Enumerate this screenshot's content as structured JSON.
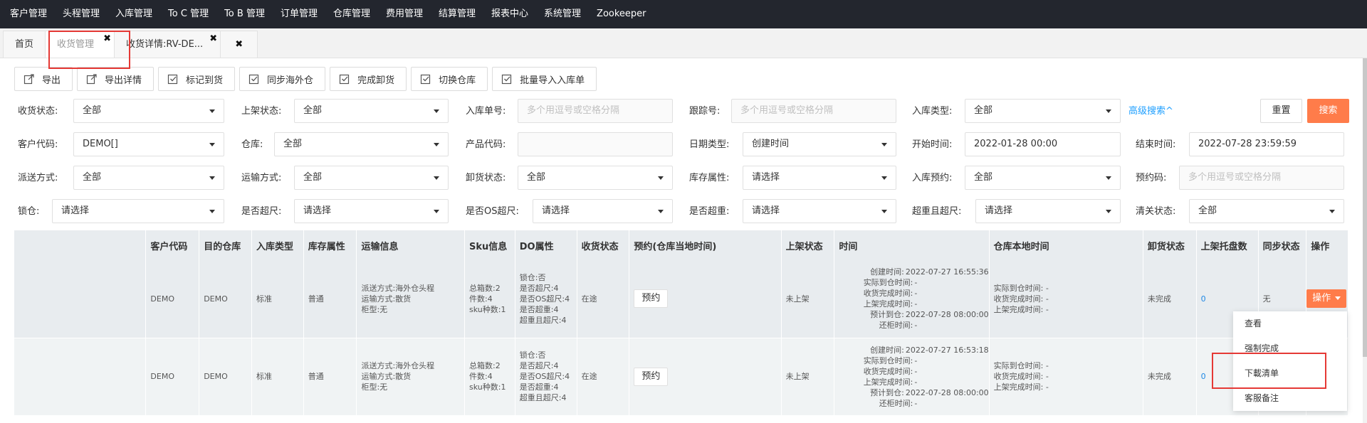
{
  "nav": [
    {
      "label": "客户管理"
    },
    {
      "label": "头程管理"
    },
    {
      "label": "入库管理"
    },
    {
      "label": "To C 管理"
    },
    {
      "label": "To B 管理"
    },
    {
      "label": "订单管理"
    },
    {
      "label": "仓库管理"
    },
    {
      "label": "费用管理"
    },
    {
      "label": "结算管理"
    },
    {
      "label": "报表中心"
    },
    {
      "label": "系统管理"
    },
    {
      "label": "Zookeeper"
    }
  ],
  "tabs": [
    {
      "label": "首页"
    },
    {
      "label": "收货管理",
      "close": "✖"
    },
    {
      "label": "收货详情:RV-DE...",
      "close": "✖"
    },
    {
      "label": "✖"
    }
  ],
  "toolbar": [
    {
      "label": "导出",
      "icon": "export-icon"
    },
    {
      "label": "导出详情",
      "icon": "export-icon"
    },
    {
      "label": "标记到货",
      "icon": "check-icon"
    },
    {
      "label": "同步海外仓",
      "icon": "check-icon"
    },
    {
      "label": "完成卸货",
      "icon": "check-icon"
    },
    {
      "label": "切换仓库",
      "icon": "check-icon"
    },
    {
      "label": "批量导入入库单",
      "icon": "check-icon"
    }
  ],
  "filters": {
    "receive_status": {
      "label": "收货状态:",
      "value": "全部"
    },
    "shelf_status": {
      "label": "上架状态:",
      "value": "全部"
    },
    "inbound_no": {
      "label": "入库单号:",
      "placeholder": "多个用逗号或空格分隔"
    },
    "tracking_no": {
      "label": "跟踪号:",
      "placeholder": "多个用逗号或空格分隔"
    },
    "inbound_type": {
      "label": "入库类型:",
      "value": "全部"
    },
    "advanced": "高级搜索^",
    "reset": "重置",
    "search": "搜索",
    "customer_code": {
      "label": "客户代码:",
      "value": "DEMO[]"
    },
    "warehouse": {
      "label": "仓库:",
      "value": "全部"
    },
    "product_code": {
      "label": "产品代码:",
      "placeholder": ""
    },
    "date_type": {
      "label": "日期类型:",
      "value": "创建时间"
    },
    "start_time": {
      "label": "开始时间:",
      "value": "2022-01-28 00:00"
    },
    "end_time": {
      "label": "结束时间:",
      "value": "2022-07-28 23:59:59"
    },
    "delivery_method": {
      "label": "派送方式:",
      "value": "全部"
    },
    "transport_method": {
      "label": "运输方式:",
      "value": "全部"
    },
    "unload_status": {
      "label": "卸货状态:",
      "value": "全部"
    },
    "stock_attr": {
      "label": "库存属性:",
      "value": "请选择"
    },
    "inbound_appt": {
      "label": "入库预约:",
      "value": "全部"
    },
    "appt_code": {
      "label": "预约码:",
      "placeholder": "多个用逗号或空格分隔"
    },
    "lock": {
      "label": "锁仓:",
      "value": "请选择"
    },
    "oversize": {
      "label": "是否超尺:",
      "value": "请选择"
    },
    "os_oversize": {
      "label": "是否OS超尺:",
      "value": "请选择"
    },
    "overweight": {
      "label": "是否超重:",
      "value": "请选择"
    },
    "ow_oversize": {
      "label": "超重且超尺:",
      "value": "请选择"
    },
    "customs_status": {
      "label": "清关状态:",
      "value": "全部"
    }
  },
  "table": {
    "headers": [
      "",
      "客户代码",
      "目的仓库",
      "入库类型",
      "库存属性",
      "运输信息",
      "Sku信息",
      "DO属性",
      "收货状态",
      "预约(仓库当地时间)",
      "上架状态",
      "时间",
      "仓库本地时间",
      "卸货状态",
      "上架托盘数",
      "同步状态",
      "操作"
    ],
    "rows": [
      {
        "customer": "DEMO",
        "dest": "DEMO",
        "type": "标准",
        "stock": "普通",
        "transport": [
          "派送方式:海外仓头程",
          "运输方式:散货",
          "柜型:无"
        ],
        "sku": [
          "总箱数:2",
          "件数:4",
          "sku种数:1"
        ],
        "do": [
          "锁仓:否",
          "是否超尺:4",
          "是否OS超尺:4",
          "是否超重:4",
          "超重且超尺:4"
        ],
        "receive_status": "在途",
        "appt_btn": "预约",
        "shelf_status": "未上架",
        "times": [
          {
            "k": "创建时间:",
            "v": "2022-07-27 16:55:36"
          },
          {
            "k": "实际到仓时间:",
            "v": "-"
          },
          {
            "k": "收货完成时间:",
            "v": "-"
          },
          {
            "k": "上架完成时间:",
            "v": "-"
          },
          {
            "k": "预计到仓:",
            "v": "2022-07-28 08:00:00"
          },
          {
            "k": "还柜时间:",
            "v": "-"
          }
        ],
        "local_times": [
          "实际到仓时间: -",
          "收货完成时间: -",
          "上架完成时间: -"
        ],
        "unload": "未完成",
        "pallets": "0",
        "sync": "无",
        "op": "操作"
      },
      {
        "customer": "DEMO",
        "dest": "DEMO",
        "type": "标准",
        "stock": "普通",
        "transport": [
          "派送方式:海外仓头程",
          "运输方式:散货",
          "柜型:无"
        ],
        "sku": [
          "总箱数:2",
          "件数:4",
          "sku种数:1"
        ],
        "do": [
          "锁仓:否",
          "是否超尺:4",
          "是否OS超尺:4",
          "是否超重:4",
          "超重且超尺:4"
        ],
        "receive_status": "在途",
        "appt_btn": "预约",
        "shelf_status": "未上架",
        "times": [
          {
            "k": "创建时间:",
            "v": "2022-07-27 16:53:18"
          },
          {
            "k": "实际到仓时间:",
            "v": "-"
          },
          {
            "k": "收货完成时间:",
            "v": "-"
          },
          {
            "k": "上架完成时间:",
            "v": "-"
          },
          {
            "k": "预计到仓:",
            "v": "2022-07-28 08:00:00"
          },
          {
            "k": "还柜时间:",
            "v": "-"
          }
        ],
        "local_times": [
          "实际到仓时间: -",
          "收货完成时间: -",
          "上架完成时间: -"
        ],
        "unload": "未完成",
        "pallets": "0",
        "sync": "",
        "op": ""
      }
    ]
  },
  "dropdown": [
    {
      "label": "查看"
    },
    {
      "label": "强制完成"
    },
    {
      "label": "下載清单"
    },
    {
      "label": "客服备注"
    }
  ],
  "colors": {
    "accent": "#ff7c4a",
    "link": "#1e9fff",
    "highlight": "#e53935"
  }
}
